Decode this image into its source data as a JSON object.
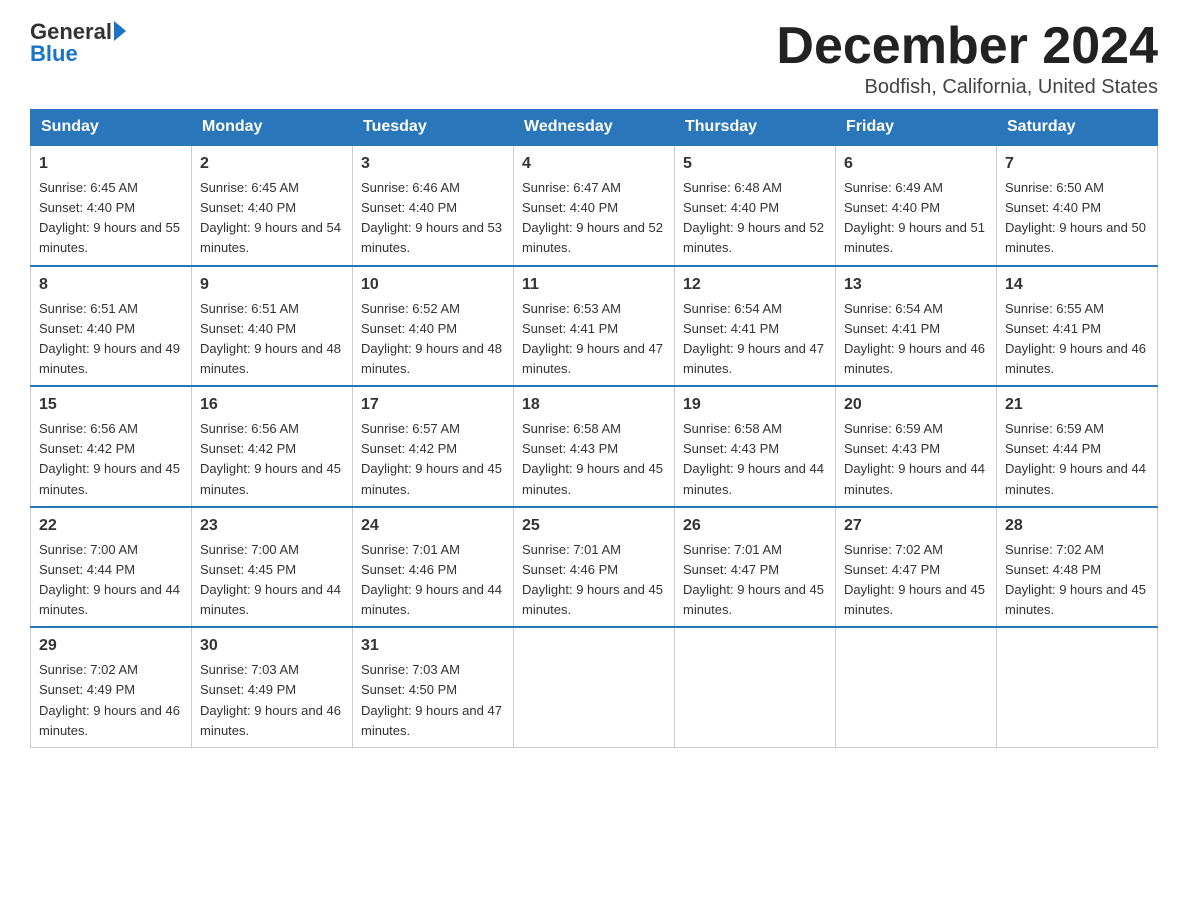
{
  "header": {
    "logo_text_general": "General",
    "logo_text_blue": "Blue",
    "title": "December 2024",
    "subtitle": "Bodfish, California, United States"
  },
  "weekdays": [
    "Sunday",
    "Monday",
    "Tuesday",
    "Wednesday",
    "Thursday",
    "Friday",
    "Saturday"
  ],
  "weeks": [
    [
      {
        "day": "1",
        "sunrise": "6:45 AM",
        "sunset": "4:40 PM",
        "daylight": "9 hours and 55 minutes."
      },
      {
        "day": "2",
        "sunrise": "6:45 AM",
        "sunset": "4:40 PM",
        "daylight": "9 hours and 54 minutes."
      },
      {
        "day": "3",
        "sunrise": "6:46 AM",
        "sunset": "4:40 PM",
        "daylight": "9 hours and 53 minutes."
      },
      {
        "day": "4",
        "sunrise": "6:47 AM",
        "sunset": "4:40 PM",
        "daylight": "9 hours and 52 minutes."
      },
      {
        "day": "5",
        "sunrise": "6:48 AM",
        "sunset": "4:40 PM",
        "daylight": "9 hours and 52 minutes."
      },
      {
        "day": "6",
        "sunrise": "6:49 AM",
        "sunset": "4:40 PM",
        "daylight": "9 hours and 51 minutes."
      },
      {
        "day": "7",
        "sunrise": "6:50 AM",
        "sunset": "4:40 PM",
        "daylight": "9 hours and 50 minutes."
      }
    ],
    [
      {
        "day": "8",
        "sunrise": "6:51 AM",
        "sunset": "4:40 PM",
        "daylight": "9 hours and 49 minutes."
      },
      {
        "day": "9",
        "sunrise": "6:51 AM",
        "sunset": "4:40 PM",
        "daylight": "9 hours and 48 minutes."
      },
      {
        "day": "10",
        "sunrise": "6:52 AM",
        "sunset": "4:40 PM",
        "daylight": "9 hours and 48 minutes."
      },
      {
        "day": "11",
        "sunrise": "6:53 AM",
        "sunset": "4:41 PM",
        "daylight": "9 hours and 47 minutes."
      },
      {
        "day": "12",
        "sunrise": "6:54 AM",
        "sunset": "4:41 PM",
        "daylight": "9 hours and 47 minutes."
      },
      {
        "day": "13",
        "sunrise": "6:54 AM",
        "sunset": "4:41 PM",
        "daylight": "9 hours and 46 minutes."
      },
      {
        "day": "14",
        "sunrise": "6:55 AM",
        "sunset": "4:41 PM",
        "daylight": "9 hours and 46 minutes."
      }
    ],
    [
      {
        "day": "15",
        "sunrise": "6:56 AM",
        "sunset": "4:42 PM",
        "daylight": "9 hours and 45 minutes."
      },
      {
        "day": "16",
        "sunrise": "6:56 AM",
        "sunset": "4:42 PM",
        "daylight": "9 hours and 45 minutes."
      },
      {
        "day": "17",
        "sunrise": "6:57 AM",
        "sunset": "4:42 PM",
        "daylight": "9 hours and 45 minutes."
      },
      {
        "day": "18",
        "sunrise": "6:58 AM",
        "sunset": "4:43 PM",
        "daylight": "9 hours and 45 minutes."
      },
      {
        "day": "19",
        "sunrise": "6:58 AM",
        "sunset": "4:43 PM",
        "daylight": "9 hours and 44 minutes."
      },
      {
        "day": "20",
        "sunrise": "6:59 AM",
        "sunset": "4:43 PM",
        "daylight": "9 hours and 44 minutes."
      },
      {
        "day": "21",
        "sunrise": "6:59 AM",
        "sunset": "4:44 PM",
        "daylight": "9 hours and 44 minutes."
      }
    ],
    [
      {
        "day": "22",
        "sunrise": "7:00 AM",
        "sunset": "4:44 PM",
        "daylight": "9 hours and 44 minutes."
      },
      {
        "day": "23",
        "sunrise": "7:00 AM",
        "sunset": "4:45 PM",
        "daylight": "9 hours and 44 minutes."
      },
      {
        "day": "24",
        "sunrise": "7:01 AM",
        "sunset": "4:46 PM",
        "daylight": "9 hours and 44 minutes."
      },
      {
        "day": "25",
        "sunrise": "7:01 AM",
        "sunset": "4:46 PM",
        "daylight": "9 hours and 45 minutes."
      },
      {
        "day": "26",
        "sunrise": "7:01 AM",
        "sunset": "4:47 PM",
        "daylight": "9 hours and 45 minutes."
      },
      {
        "day": "27",
        "sunrise": "7:02 AM",
        "sunset": "4:47 PM",
        "daylight": "9 hours and 45 minutes."
      },
      {
        "day": "28",
        "sunrise": "7:02 AM",
        "sunset": "4:48 PM",
        "daylight": "9 hours and 45 minutes."
      }
    ],
    [
      {
        "day": "29",
        "sunrise": "7:02 AM",
        "sunset": "4:49 PM",
        "daylight": "9 hours and 46 minutes."
      },
      {
        "day": "30",
        "sunrise": "7:03 AM",
        "sunset": "4:49 PM",
        "daylight": "9 hours and 46 minutes."
      },
      {
        "day": "31",
        "sunrise": "7:03 AM",
        "sunset": "4:50 PM",
        "daylight": "9 hours and 47 minutes."
      },
      null,
      null,
      null,
      null
    ]
  ]
}
